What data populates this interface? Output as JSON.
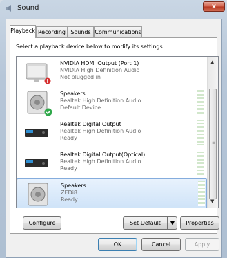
{
  "window": {
    "title": "Sound",
    "close_label": "x",
    "title_icon": "speaker-icon"
  },
  "tabs": [
    {
      "label": "Playback",
      "active": true
    },
    {
      "label": "Recording",
      "active": false
    },
    {
      "label": "Sounds",
      "active": false
    },
    {
      "label": "Communications",
      "active": false
    }
  ],
  "instruction": "Select a playback device below to modify its settings:",
  "devices": [
    {
      "name": "NVIDIA HDMI Output (Port 1)",
      "driver": "NVIDIA High Definition Audio",
      "status": "Not plugged in",
      "icon": "monitor-icon",
      "badge": "unplugged-badge",
      "level_meter": false,
      "selected": false
    },
    {
      "name": "Speakers",
      "driver": "Realtek High Definition Audio",
      "status": "Default Device",
      "icon": "speaker-icon",
      "badge": "default-check-badge",
      "level_meter": true,
      "selected": false
    },
    {
      "name": "Realtek Digital Output",
      "driver": "Realtek High Definition Audio",
      "status": "Ready",
      "icon": "digital-output-icon",
      "badge": "",
      "level_meter": true,
      "selected": false
    },
    {
      "name": "Realtek Digital Output(Optical)",
      "driver": "Realtek High Definition Audio",
      "status": "Ready",
      "icon": "digital-output-icon",
      "badge": "",
      "level_meter": true,
      "selected": false
    },
    {
      "name": "Speakers",
      "driver": "ZEDi8",
      "status": "Ready",
      "icon": "speaker-icon",
      "badge": "",
      "level_meter": true,
      "selected": true
    }
  ],
  "buttons": {
    "configure": "Configure",
    "set_default": "Set Default",
    "set_default_arrow": "▼",
    "properties": "Properties",
    "ok": "OK",
    "cancel": "Cancel",
    "apply": "Apply"
  },
  "scrollbar": {
    "up": "▲",
    "down": "▼",
    "grip": "≡"
  },
  "colors": {
    "selection_border": "#84acdd",
    "default_check": "#2fa84a",
    "unplugged": "#d62f2f"
  }
}
